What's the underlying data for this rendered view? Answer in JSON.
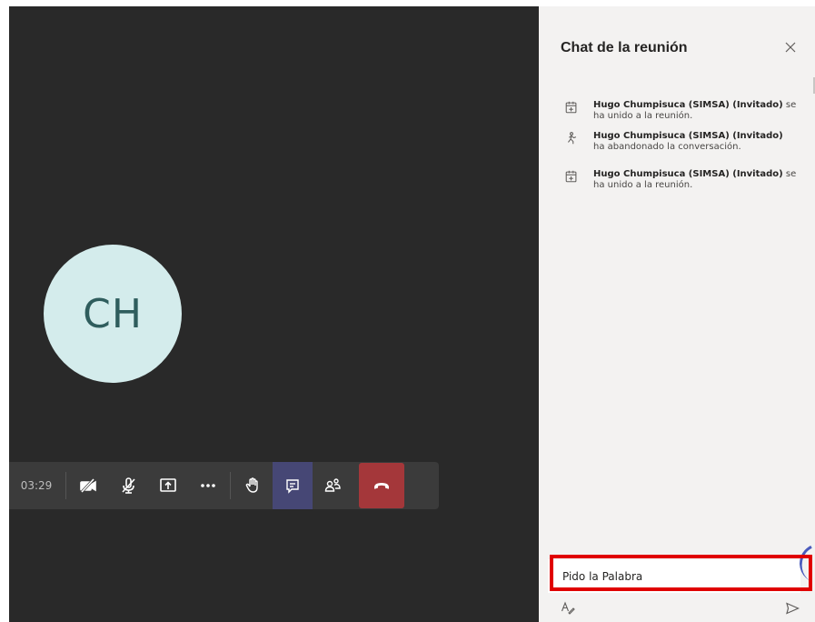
{
  "call": {
    "avatar_initials": "CH",
    "timer": "03:29",
    "toolbar": {
      "camera_icon": "camera-off-icon",
      "mic_icon": "mic-off-icon",
      "share_icon": "share-screen-icon",
      "more_icon": "more-icon",
      "raise_hand_icon": "raise-hand-icon",
      "chat_icon": "chat-icon",
      "participants_icon": "participants-icon",
      "hangup_icon": "hang-up-icon"
    }
  },
  "chat": {
    "title": "Chat de la reunión",
    "messages": [
      {
        "icon": "joined-icon",
        "name": "Hugo Chumpisuca (SIMSA) (Invitado)",
        "text": " se ha unido a la reunión."
      },
      {
        "icon": "left-icon",
        "name": "Hugo Chumpisuca (SIMSA) (Invitado)",
        "text": " ha abandonado la conversación."
      },
      {
        "icon": "joined-icon",
        "name": "Hugo Chumpisuca (SIMSA) (Invitado)",
        "text": " se ha unido a la reunión."
      }
    ],
    "compose_value": "Pido la Palabra"
  },
  "colors": {
    "stage_bg": "#292929",
    "panel_bg": "#f3f2f1",
    "active_button": "#464775",
    "hangup": "#a4373a",
    "highlight": "#e00000"
  }
}
